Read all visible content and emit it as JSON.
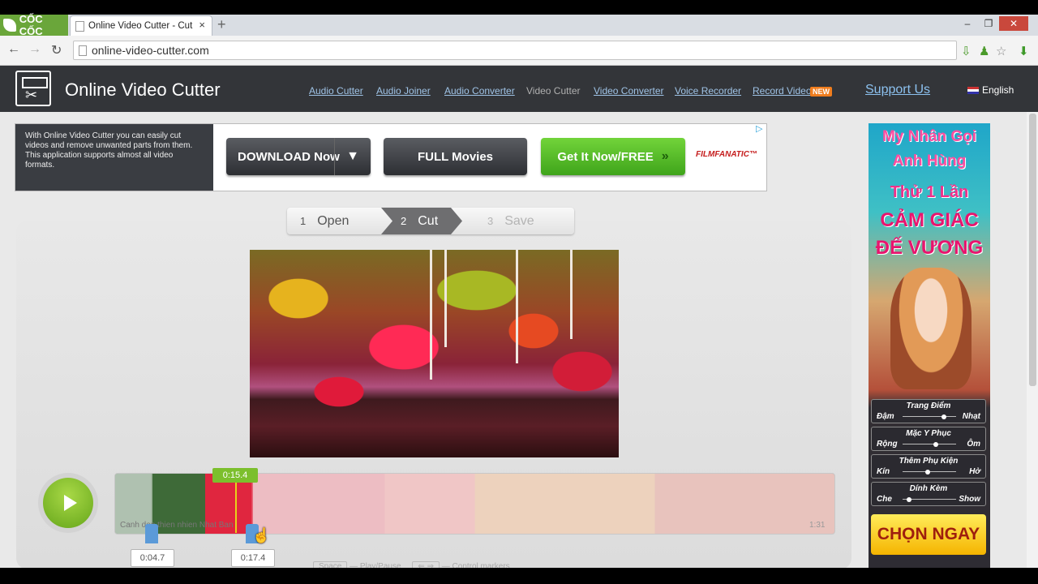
{
  "browser": {
    "brand": "CỐC CỐC",
    "tab_title": "Online Video Cutter - Cut",
    "tab_close": "×",
    "new_tab": "+",
    "url": "online-video-cutter.com",
    "window_controls": [
      "‒",
      "❐",
      "✕"
    ]
  },
  "site": {
    "title": "Online Video Cutter",
    "nav": [
      "Audio Cutter",
      "Audio Joiner",
      "Audio Converter",
      "Video Cutter",
      "Video Converter",
      "Voice Recorder",
      "Record Video"
    ],
    "new_badge": "NEW",
    "support": "Support Us",
    "language": "English"
  },
  "top_ad": {
    "text": "With Online Video Cutter you can easily cut videos and remove unwanted parts from them. This application supports almost all video formats.",
    "download": "DOWNLOAD Now",
    "full_movies": "FULL Movies",
    "get_it": "Get It Now/FREE",
    "sponsor": "FILMFANATIC™",
    "adchoice": "▷"
  },
  "side_ad": {
    "line1": "My Nhân Gọi",
    "line2": "Anh Hùng",
    "line3": "Thử 1 Lần",
    "line4": "CẢM GIÁC",
    "line5": "ĐẾ VƯƠNG",
    "sliders": [
      {
        "title": "Trang Điểm",
        "left": "Đậm",
        "right": "Nhạt",
        "pos": 0.75
      },
      {
        "title": "Mặc Y Phục",
        "left": "Rộng",
        "right": "Ôm",
        "pos": 0.6
      },
      {
        "title": "Thêm Phụ Kiện",
        "left": "Kín",
        "right": "Hở",
        "pos": 0.45
      },
      {
        "title": "Dính Kèm",
        "left": "Che",
        "right": "Show",
        "pos": 0.12
      }
    ],
    "cta": "CHỌN NGAY"
  },
  "steps": [
    {
      "num": "1",
      "label": "Open"
    },
    {
      "num": "2",
      "label": "Cut"
    },
    {
      "num": "3",
      "label": "Save"
    }
  ],
  "player": {
    "current_time": "0:15.4",
    "start_marker": "0:04.7",
    "end_marker": "0:17.4",
    "clip_name": "Canh dep thien nhien Nhat Ban",
    "duration": "1:31",
    "hint_space": "Space",
    "hint_play": "Play/Pause",
    "hint_controls": "Control markers"
  },
  "colors": {
    "header_bg": "#333539",
    "accent_green": "#7cbf2d",
    "link_blue": "#9fc3e6",
    "marker_blue": "#5b9ad8"
  }
}
